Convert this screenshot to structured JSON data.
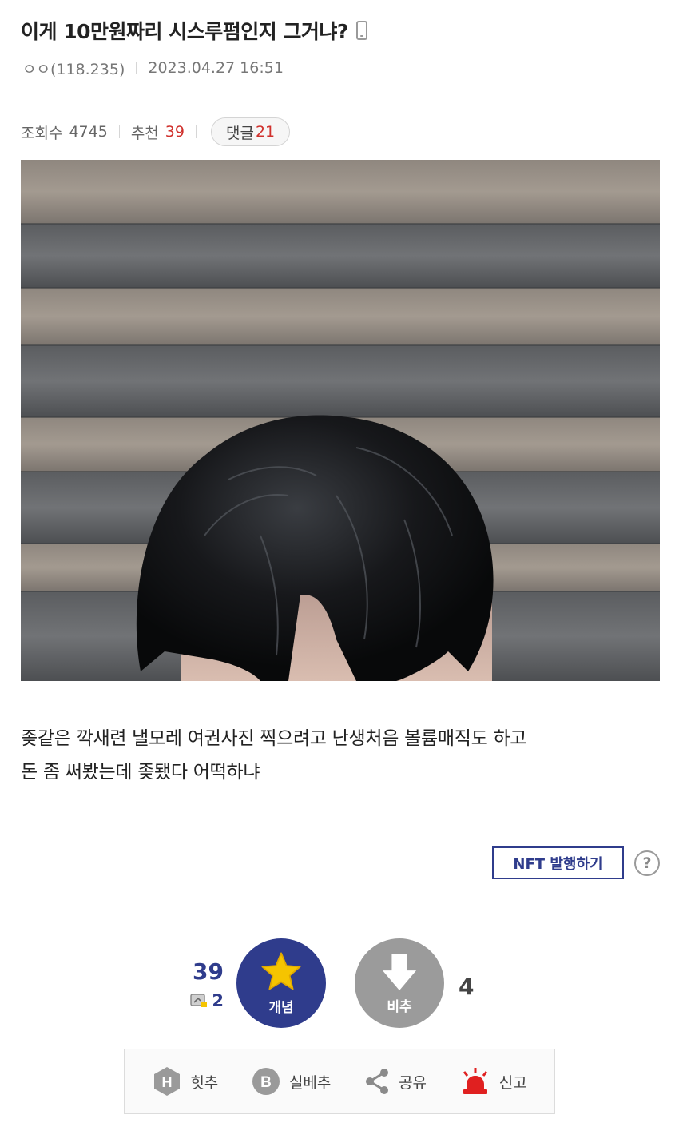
{
  "post": {
    "title": "이게 10만원짜리 시스루펌인지 그거냐?",
    "author": "ㅇㅇ(118.235)",
    "date": "2023.04.27 16:51",
    "views_label": "조회수",
    "views": "4745",
    "recommend_label": "추천",
    "recommend": "39",
    "comments_label": "댓글",
    "comments": "21",
    "body_line1": "좆같은 깍새련 낼모레 여권사진 찍으려고 난생처음 볼륨매직도 하고",
    "body_line2": "돈 좀 써봤는데 좆됐다 어떡하냐"
  },
  "nft": {
    "button_label": "NFT 발행하기",
    "help_label": "?"
  },
  "vote": {
    "up_count": "39",
    "fix_count": "2",
    "up_label": "개념",
    "down_label": "비추",
    "down_count": "4"
  },
  "actions": [
    {
      "label": "힛추",
      "icon": "hit-icon"
    },
    {
      "label": "실베추",
      "icon": "best-icon"
    },
    {
      "label": "공유",
      "icon": "share-icon"
    },
    {
      "label": "신고",
      "icon": "siren-icon"
    }
  ],
  "colors": {
    "accent": "#2f3c8c",
    "downvote": "#9b9b9b",
    "highlight_red": "#d0312d",
    "star": "#f5c400"
  }
}
